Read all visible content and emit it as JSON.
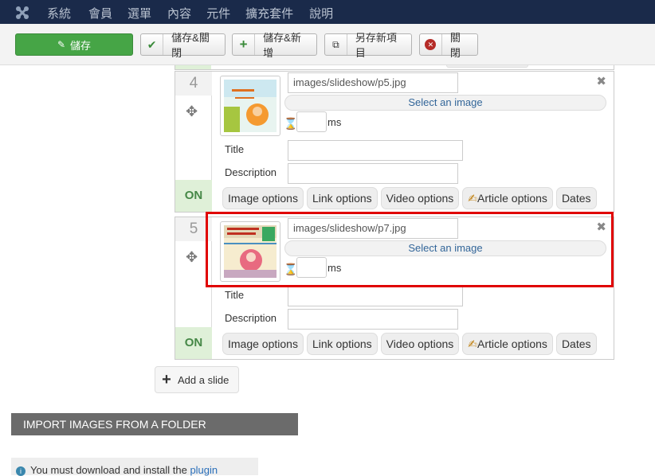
{
  "topnav": {
    "menu": [
      "系統",
      "會員",
      "選單",
      "內容",
      "元件",
      "擴充套件",
      "說明"
    ]
  },
  "toolbar": {
    "save": "儲存",
    "save_close": "儲存&關閉",
    "save_new": "儲存&新增",
    "save_copy": "另存新項目",
    "close": "關閉"
  },
  "slides": [
    {
      "number": "4",
      "image_path": "images/slideshow/p5.jpg",
      "select_image": "Select an image",
      "ms": "ms",
      "title_label": "Title",
      "description_label": "Description",
      "status": "ON",
      "tabs": [
        "Image options",
        "Link options",
        "Video options",
        "Article options",
        "Dates"
      ]
    },
    {
      "number": "5",
      "image_path": "images/slideshow/p7.jpg",
      "select_image": "Select an image",
      "ms": "ms",
      "title_label": "Title",
      "description_label": "Description",
      "status": "ON",
      "tabs": [
        "Image options",
        "Link options",
        "Video options",
        "Article options",
        "Dates"
      ]
    }
  ],
  "add_slide": "Add a slide",
  "import_header": "IMPORT IMAGES FROM A FOLDER",
  "info": {
    "text": "You must download and install the ",
    "link": "plugin"
  },
  "colors": {
    "nav_bg": "#1a2a4a",
    "save_green": "#46a546",
    "on_green": "#dff0d8",
    "highlight_red": "#e00000"
  }
}
